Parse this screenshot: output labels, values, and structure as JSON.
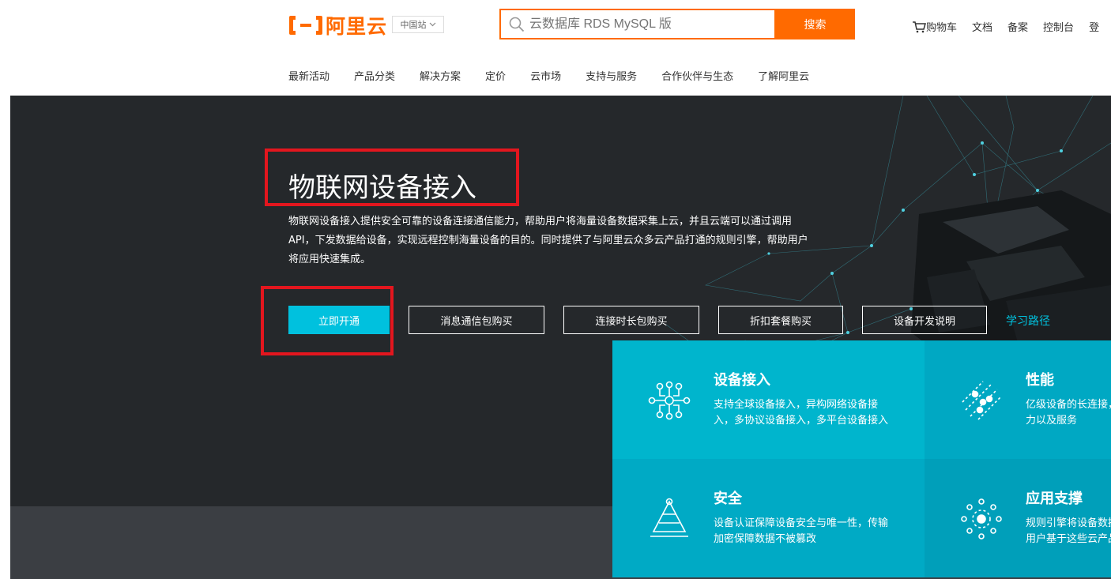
{
  "header": {
    "logo_text": "阿里云",
    "region_label": "中国站",
    "search_placeholder": "云数据库 RDS MySQL 版",
    "search_button": "搜索",
    "links": [
      "购物车",
      "文档",
      "备案",
      "控制台",
      "登"
    ]
  },
  "nav": [
    "最新活动",
    "产品分类",
    "解决方案",
    "定价",
    "云市场",
    "支持与服务",
    "合作伙伴与生态",
    "了解阿里云"
  ],
  "hero": {
    "title": "物联网设备接入",
    "description": "物联网设备接入提供安全可靠的设备连接通信能力，帮助用户将海量设备数据采集上云，并且云端可以通过调用API，下发数据给设备，实现远程控制海量设备的目的。同时提供了与阿里云众多云产品打通的规则引擎，帮助用户将应用快速集成。",
    "buttons": [
      "立即开通",
      "消息通信包购买",
      "连接时长包购买",
      "折扣套餐购买",
      "设备开发说明"
    ],
    "learn_link": "学习路径"
  },
  "features": [
    {
      "title": "设备接入",
      "desc": "支持全球设备接入，异构网络设备接入，多协议设备接入，多平台设备接入",
      "icon": "device-access-icon"
    },
    {
      "title": "性能",
      "desc": "亿级设备的长连接，百万消息并发的能力以及服务",
      "icon": "performance-icon"
    },
    {
      "title": "安全",
      "desc": "设备认证保障设备安全与唯一性，传输加密保障数据不被篡改",
      "icon": "security-icon"
    },
    {
      "title": "应用支撑",
      "desc": "规则引擎将设备数据与阿里云云产品，用户基于这些云产品应用",
      "icon": "app-support-icon"
    }
  ],
  "colors": {
    "brand": "#ff6a00",
    "accent": "#00c1de",
    "hero_bg": "#25282b",
    "annotation": "#e3161e"
  }
}
